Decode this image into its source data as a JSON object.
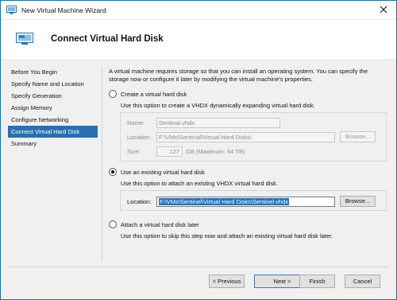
{
  "window": {
    "title": "New Virtual Machine Wizard"
  },
  "header": {
    "title": "Connect Virtual Hard Disk"
  },
  "sidebar": {
    "items": [
      {
        "label": "Before You Begin"
      },
      {
        "label": "Specify Name and Location"
      },
      {
        "label": "Specify Generation"
      },
      {
        "label": "Assign Memory"
      },
      {
        "label": "Configure Networking"
      },
      {
        "label": "Connect Virtual Hard Disk"
      },
      {
        "label": "Summary"
      }
    ],
    "active_index": 5
  },
  "intro": "A virtual machine requires storage so that you can install an operating system. You can specify the storage now or configure it later by modifying the virtual machine's properties.",
  "options": {
    "create": {
      "label": "Create a virtual hard disk",
      "description": "Use this option to create a VHDX dynamically expanding virtual hard disk.",
      "selected": false,
      "name_label": "Name:",
      "name_value": "Sentinal.vhdx",
      "location_label": "Location:",
      "location_value": "F:\\VMs\\Sentinal\\Virtual Hard Disks\\",
      "browse_label": "Browse...",
      "size_label": "Size:",
      "size_value": "127",
      "size_unit": "GB (Maximum: 64 TB)"
    },
    "existing": {
      "label": "Use an existing virtual hard disk",
      "description": "Use this option to attach an existing VHDX virtual hard disk.",
      "selected": true,
      "location_label": "Location:",
      "location_value": "F:\\VMs\\Sentinel\\Virtual Hard Disks\\Sentinel.vhdx",
      "browse_label": "Browse..."
    },
    "later": {
      "label": "Attach a virtual hard disk later",
      "description": "Use this option to skip this step now and attach an existing virtual hard disk later.",
      "selected": false
    }
  },
  "footer": {
    "previous_label": "< Previous",
    "next_label": "Next >",
    "finish_label": "Finish",
    "cancel_label": "Cancel"
  },
  "colors": {
    "accent": "#2a6fb0",
    "window_border": "#1f6fb5"
  }
}
